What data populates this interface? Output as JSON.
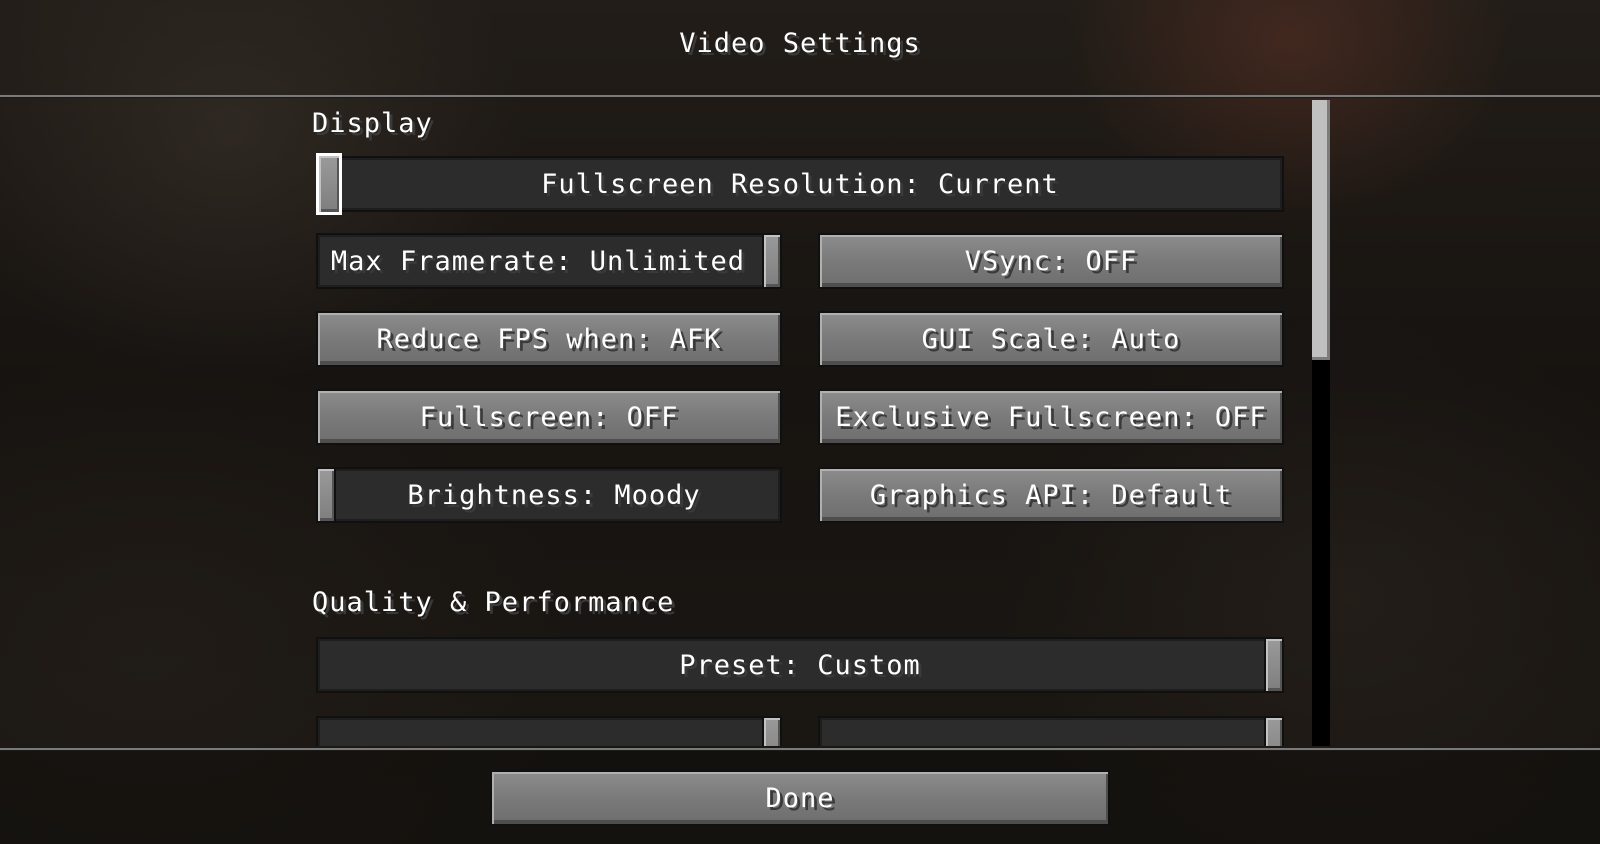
{
  "screen": {
    "title": "Video Settings"
  },
  "sections": {
    "display_label": "Display",
    "quality_label": "Quality & Performance"
  },
  "options": {
    "fullscreen_resolution": "Fullscreen Resolution: Current",
    "max_framerate": "Max Framerate: Unlimited",
    "vsync": "VSync: OFF",
    "reduce_fps": "Reduce FPS when: AFK",
    "gui_scale": "GUI Scale: Auto",
    "fullscreen": "Fullscreen: OFF",
    "exclusive_fullscreen": "Exclusive Fullscreen: OFF",
    "brightness": "Brightness: Moody",
    "graphics_api": "Graphics API: Default",
    "preset": "Preset: Custom"
  },
  "slider_levels": {
    "fullscreen_resolution": 0.0,
    "max_framerate": 1.0,
    "brightness": 0.0,
    "preset": 1.0
  },
  "footer": {
    "done_label": "Done"
  },
  "colors": {
    "button_face": "#7a7a7a",
    "slider_track": "#2c2c2c",
    "text": "#ffffff",
    "text_shadow": "#3a3a3a",
    "focus_outline": "#ffffff"
  }
}
